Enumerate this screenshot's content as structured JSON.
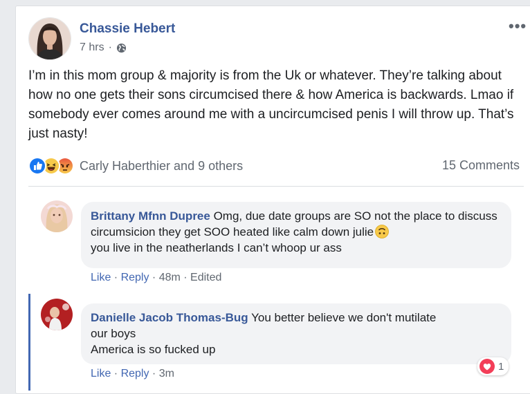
{
  "post": {
    "author": "Chassie Hebert",
    "time": "7 hrs",
    "separator": "·",
    "privacy_icon": "globe-icon",
    "more_icon": "•••",
    "text": "I’m in this mom group & majority is from the Uk or whatever. They’re talking about how no one gets their sons circumcised there & how America is backwards. Lmao if somebody ever comes around me with a uncircumcised penis I will throw up. That’s just nasty!",
    "reactions": {
      "icons": [
        "like-reaction-icon",
        "haha-reaction-icon",
        "angry-reaction-icon"
      ],
      "names": "Carly Haberthier and 9 others"
    },
    "comment_count": "15 Comments"
  },
  "comments": [
    {
      "author": "Brittany Mfnn Dupree",
      "text": "Omg, due date groups are SO not the place to discuss circumsicion they get SOO heated like calm down julie",
      "text2": "you live in the neatherlands I can’t whoop ur ass",
      "emoji": "upside-down-face-icon",
      "like": "Like",
      "reply": "Reply",
      "time": "48m",
      "edited": "Edited"
    },
    {
      "author": "Danielle Jacob Thomas-Bug",
      "text": "You better believe we don't mutilate",
      "text2": "our boys",
      "text3": "America is so fucked up",
      "like": "Like",
      "reply": "Reply",
      "time": "3m",
      "reaction_count": "1",
      "reaction_icon": "love-reaction-icon"
    }
  ],
  "colors": {
    "link": "#385898",
    "like_blue": "#4267b2",
    "muted": "#606770",
    "bubble": "#f2f3f5"
  }
}
